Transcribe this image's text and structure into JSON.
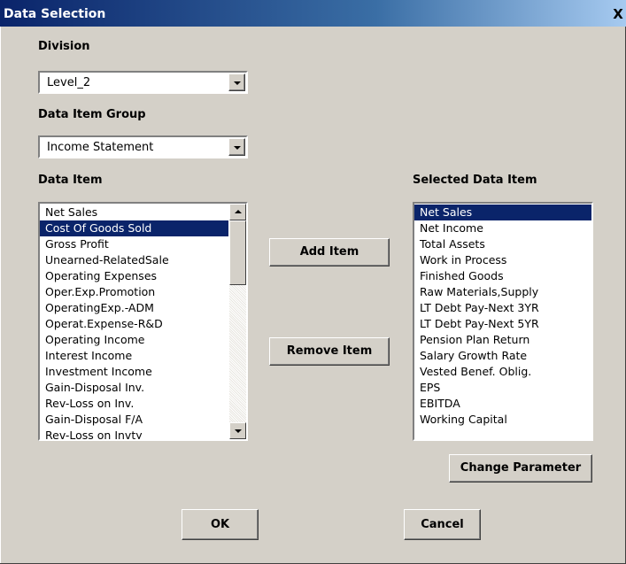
{
  "window": {
    "title": "Data Selection",
    "close_glyph": "X"
  },
  "division": {
    "label": "Division",
    "value": "Level_2"
  },
  "data_item_group": {
    "label": "Data Item Group",
    "value": "Income Statement"
  },
  "data_item": {
    "label": "Data Item",
    "selected_index": 1,
    "items": [
      "Net Sales",
      "Cost Of Goods Sold",
      "Gross Profit",
      "Unearned-RelatedSale",
      "Operating Expenses",
      "Oper.Exp.Promotion",
      "OperatingExp.-ADM",
      "Operat.Expense-R&D",
      "Operating Income",
      "Interest Income",
      "Investment Income",
      "Gain-Disposal Inv.",
      "Rev-Loss on Inv.",
      "Gain-Disposal F/A",
      "Rev-Loss on Invty"
    ]
  },
  "selected_data_item": {
    "label": "Selected Data Item",
    "selected_index": 0,
    "items": [
      "Net Sales",
      "Net Income",
      "Total Assets",
      "Work in Process",
      "Finished Goods",
      "Raw Materials,Supply",
      "LT Debt Pay-Next 3YR",
      "LT Debt Pay-Next 5YR",
      "Pension Plan Return",
      "Salary Growth Rate",
      "Vested Benef. Oblig.",
      "EPS",
      "EBITDA",
      "Working Capital"
    ]
  },
  "buttons": {
    "add_item": "Add Item",
    "remove_item": "Remove Item",
    "change_parameter": "Change Parameter",
    "ok": "OK",
    "cancel": "Cancel"
  },
  "colors": {
    "title_bar": "#0a246a",
    "selection": "#0a246a",
    "dialog_bg": "#d4d0c8"
  }
}
